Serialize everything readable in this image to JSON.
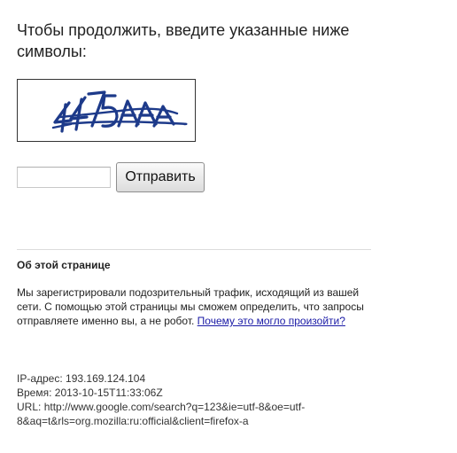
{
  "heading": {
    "line1": "Чтобы продолжить, введите указанные ниже",
    "line2": "символы:"
  },
  "captcha": {
    "image_text": "4475AAA"
  },
  "form": {
    "input_value": "",
    "submit_label": "Отправить"
  },
  "about": {
    "title": "Об этой странице",
    "text": "Мы зарегистрировали подозрительный трафик, исходящий из вашей сети. С помощью этой страницы мы сможем определить, что запросы отправляете именно вы, а не робот.",
    "link": "Почему это могло произойти?"
  },
  "info": {
    "ip_label": "IP-адрес:",
    "ip_value": "193.169.124.104",
    "time_label": "Время:",
    "time_value": "2013-10-15T11:33:06Z",
    "url_label": "URL:",
    "url_line1": "http://www.google.com/search?q=123&ie=utf-8&oe=utf-",
    "url_line2": "8&aq=t&rls=org.mozilla:ru:official&client=firefox-a"
  },
  "colors": {
    "captcha_ink": "#1d3a8a",
    "link": "#1a1aa6"
  }
}
